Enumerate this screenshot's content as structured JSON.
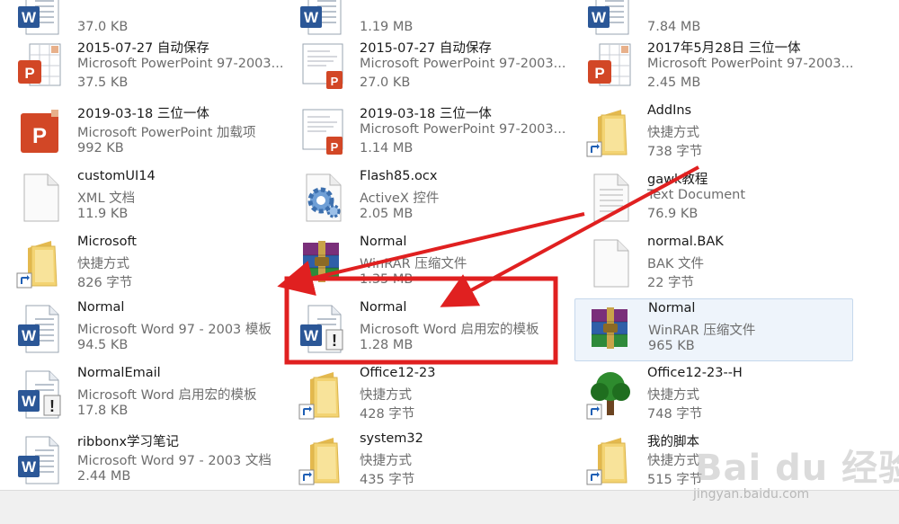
{
  "files": [
    {
      "name": "",
      "type": "",
      "size": "37.0 KB",
      "icon": "word-doc-icon"
    },
    {
      "name": "",
      "type": "",
      "size": "1.19 MB",
      "icon": "word-doc-icon"
    },
    {
      "name": "",
      "type": "",
      "size": "7.84 MB",
      "icon": "word-doc-icon"
    },
    {
      "name": "2015-07-27 自动保存",
      "type": "Microsoft PowerPoint 97-2003...",
      "size": "37.5 KB",
      "icon": "powerpoint-file-icon"
    },
    {
      "name": "2015-07-27 自动保存",
      "type": "Microsoft PowerPoint 97-2003...",
      "size": "27.0 KB",
      "icon": "powerpoint-thumbnail-icon"
    },
    {
      "name": "2017年5月28日 三位一体",
      "type": "Microsoft PowerPoint 97-2003...",
      "size": "2.45 MB",
      "icon": "powerpoint-file-icon"
    },
    {
      "name": "2019-03-18  三位一体",
      "type": "Microsoft PowerPoint 加载项",
      "size": "992 KB",
      "icon": "powerpoint-addin-icon"
    },
    {
      "name": "2019-03-18  三位一体",
      "type": "Microsoft PowerPoint 97-2003...",
      "size": "1.14 MB",
      "icon": "powerpoint-thumbnail-icon"
    },
    {
      "name": "AddIns",
      "type": "快捷方式",
      "size": "738 字节",
      "icon": "folder-shortcut-icon"
    },
    {
      "name": "customUI14",
      "type": "XML 文档",
      "size": "11.9 KB",
      "icon": "blank-file-icon"
    },
    {
      "name": "Flash85.ocx",
      "type": "ActiveX 控件",
      "size": "2.05 MB",
      "icon": "activex-gear-icon"
    },
    {
      "name": "gawk教程",
      "type": "Text Document",
      "size": "76.9 KB",
      "icon": "text-file-icon"
    },
    {
      "name": "Microsoft",
      "type": "快捷方式",
      "size": "826 字节",
      "icon": "folder-shortcut-icon"
    },
    {
      "name": "Normal",
      "type": "WinRAR 压缩文件",
      "size": "1.35 MB",
      "icon": "winrar-archive-icon"
    },
    {
      "name": "normal.BAK",
      "type": "BAK 文件",
      "size": "22 字节",
      "icon": "blank-file-icon"
    },
    {
      "name": "Normal",
      "type": "Microsoft Word 97 - 2003 模板",
      "size": "94.5 KB",
      "icon": "word-doc-icon"
    },
    {
      "name": "Normal",
      "type": "Microsoft Word 启用宏的模板",
      "size": "1.28 MB",
      "icon": "word-macro-template-icon"
    },
    {
      "name": "Normal",
      "type": "WinRAR 压缩文件",
      "size": "965 KB",
      "icon": "winrar-archive-icon"
    },
    {
      "name": "NormalEmail",
      "type": "Microsoft Word 启用宏的模板",
      "size": "17.8 KB",
      "icon": "word-macro-template-icon"
    },
    {
      "name": "Office12-23",
      "type": "快捷方式",
      "size": "428 字节",
      "icon": "folder-shortcut-icon"
    },
    {
      "name": "Office12-23--H",
      "type": "快捷方式",
      "size": "748 字节",
      "icon": "tree-shortcut-icon"
    },
    {
      "name": "ribbonx学习笔记",
      "type": "Microsoft Word 97 - 2003 文档",
      "size": "2.44 MB",
      "icon": "word-doc-icon"
    },
    {
      "name": "system32",
      "type": "快捷方式",
      "size": "435 字节",
      "icon": "folder-shortcut-icon"
    },
    {
      "name": "我的脚本",
      "type": "快捷方式",
      "size": "515 字节",
      "icon": "folder-shortcut-icon"
    }
  ],
  "selected_index": 17,
  "highlighted_index": 16,
  "annotation_color": "#e02020",
  "watermark": {
    "brand": "Bai du 经验",
    "url": "jingyan.baidu.com"
  },
  "colors": {
    "word": "#2b5797",
    "powerpoint": "#d24726",
    "folder": "#f3d372",
    "winrar": "#7a2f7a",
    "shortcut": "#1f5fb5"
  }
}
